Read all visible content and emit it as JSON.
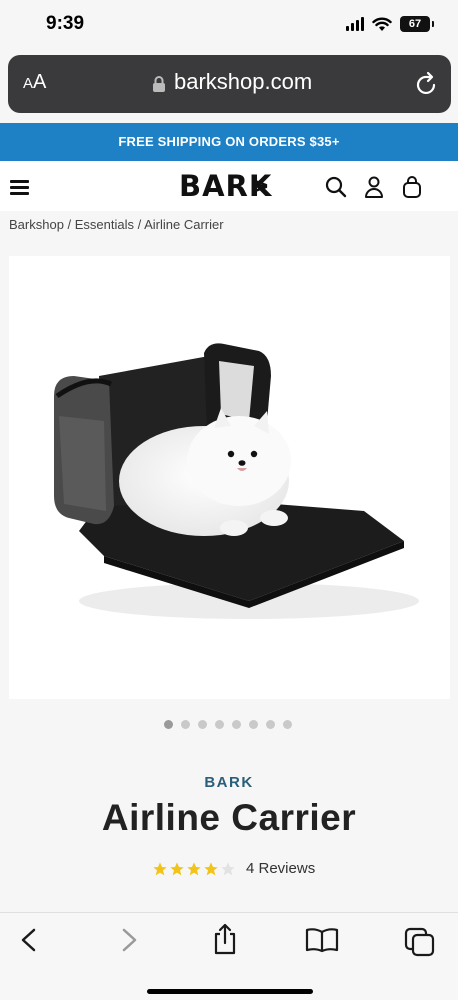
{
  "status_bar": {
    "time": "9:39",
    "battery": "67"
  },
  "browser": {
    "text_size_label_small": "A",
    "text_size_label_large": "A",
    "url": "barkshop.com"
  },
  "promo": {
    "text": "FREE SHIPPING ON ORDERS $35+"
  },
  "header": {
    "logo": "BARK"
  },
  "breadcrumb": {
    "text": "Barkshop / Essentials / Airline Carrier"
  },
  "product": {
    "brand": "BARK",
    "title": "Airline Carrier",
    "rating": 4,
    "rating_max": 5,
    "reviews": "4 Reviews",
    "image_count": 8,
    "active_image": 1
  },
  "colors": {
    "promo_bg": "#1e80c5",
    "brand_text": "#2b5e7a",
    "star": "#f2c418"
  }
}
